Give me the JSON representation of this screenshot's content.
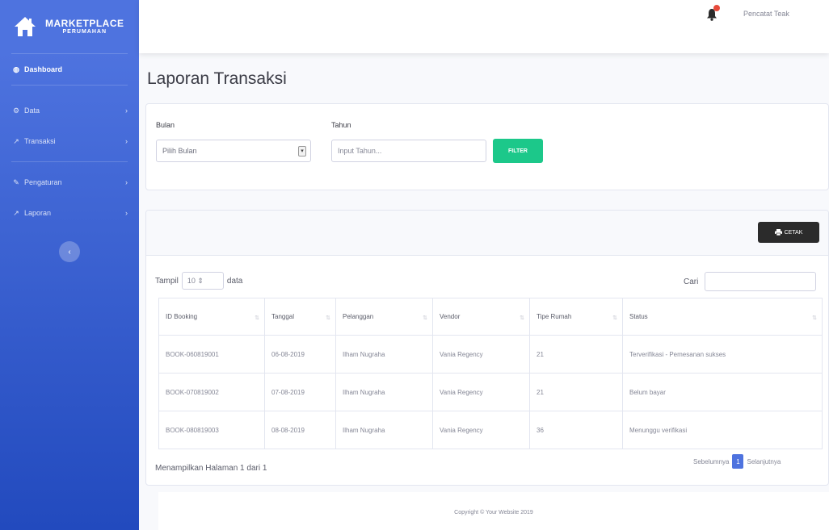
{
  "brand": {
    "title": "MARKETPLACE",
    "subtitle": "PERUMAHAN"
  },
  "sidebar": {
    "items": [
      {
        "label": "Dashboard",
        "icon": "dashboard-icon",
        "active": true
      },
      {
        "label": "Data",
        "icon": "gear-icon"
      },
      {
        "label": "Transaksi",
        "icon": "chart-icon"
      },
      {
        "label": "Pengaturan",
        "icon": "wrench-icon"
      },
      {
        "label": "Laporan",
        "icon": "chart-icon"
      }
    ]
  },
  "topbar": {
    "user_name": "Pencatat Teak"
  },
  "page": {
    "title": "Laporan Transaksi"
  },
  "filter": {
    "bulan_label": "Bulan",
    "bulan_value": "Pilih Bulan",
    "tahun_label": "Tahun",
    "tahun_placeholder": "Input Tahun...",
    "submit_label": "FILTER"
  },
  "table_card": {
    "print_label": "CETAK",
    "length_prefix": "Tampil",
    "length_value": "10",
    "length_suffix": "data",
    "search_label": "Cari",
    "columns": [
      "ID Booking",
      "Tanggal",
      "Pelanggan",
      "Vendor",
      "Tipe Rumah",
      "Status"
    ],
    "rows": [
      [
        "BOOK-060819001",
        "06-08-2019",
        "Ilham Nugraha",
        "Vania Regency",
        "21",
        "Terverifikasi - Pemesanan sukses"
      ],
      [
        "BOOK-070819002",
        "07-08-2019",
        "Ilham Nugraha",
        "Vania Regency",
        "21",
        "Belum bayar"
      ],
      [
        "BOOK-080819003",
        "08-08-2019",
        "Ilham Nugraha",
        "Vania Regency",
        "36",
        "Menunggu verifikasi"
      ]
    ],
    "info": "Menampilkan Halaman 1 dari 1",
    "prev_label": "Sebelumnya",
    "page": "1",
    "next_label": "Selanjutnya"
  },
  "footer": {
    "text": "Copyright © Your Website 2019"
  },
  "colors": {
    "sidebar": "#4e73df",
    "success": "#1cc88a",
    "dark": "#2b2b2b",
    "danger": "#e74a3b"
  }
}
